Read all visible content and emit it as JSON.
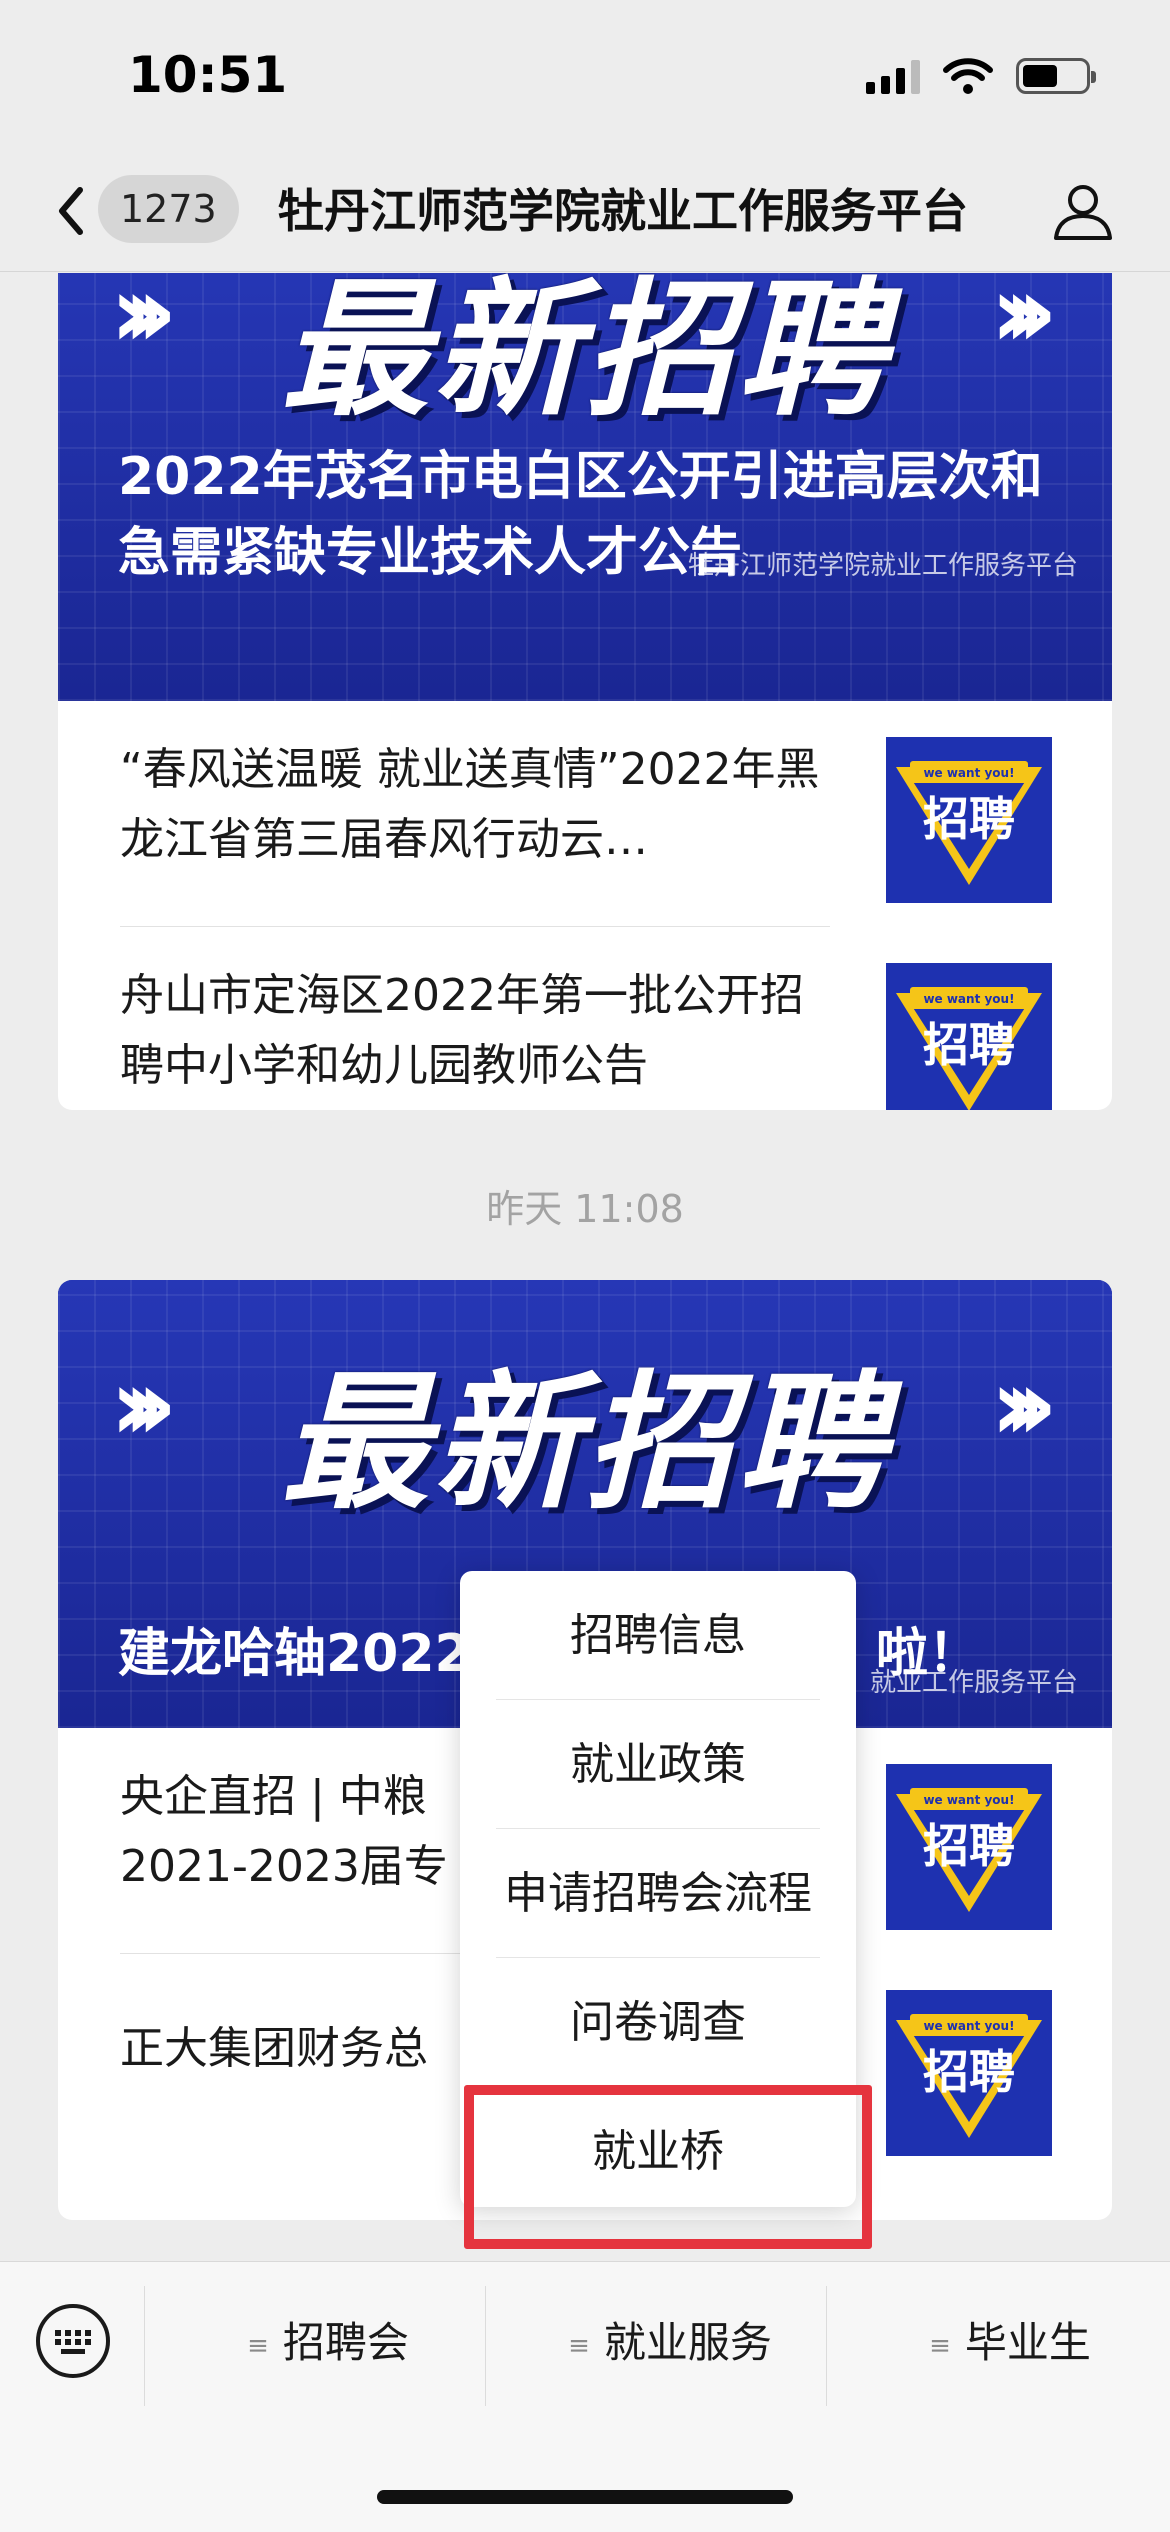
{
  "status_bar": {
    "time": "10:51"
  },
  "nav": {
    "unread_count": "1273",
    "title": "牡丹江师范学院就业工作服务平台"
  },
  "card1": {
    "banner": {
      "headline": "最新招聘",
      "caption": "2022年茂名市电白区公开引进高层次和急需紧缺专业技术人才公告",
      "watermark": "牡丹江师范学院就业工作服务平台"
    },
    "articles": [
      {
        "title": "“春风送温暖 就业送真情”2022年黑龙江省第三届春风行动云…"
      },
      {
        "title": "舟山市定海区2022年第一批公开招聘中小学和幼儿园教师公告"
      }
    ]
  },
  "timestamp": "昨天 11:08",
  "card2": {
    "banner": {
      "headline": "最新招聘",
      "caption": "建龙哈轴2022",
      "caption_tail": "啦！",
      "watermark": "就业工作服务平台"
    },
    "articles": [
      {
        "title": "央企直招 | 中粮"
      },
      {
        "title_line2": "2021-2023届专"
      },
      {
        "title": "正大集团财务总"
      }
    ]
  },
  "thumbnail": {
    "top_text": "we want you!",
    "main_text": "招聘"
  },
  "popup_menu": {
    "items": [
      "招聘信息",
      "就业政策",
      "申请招聘会流程",
      "问卷调查",
      "就业桥"
    ]
  },
  "bottom_menu": {
    "items": [
      "招聘会",
      "就业服务",
      "毕业生"
    ]
  },
  "colors": {
    "banner_blue": "#1e2a9c",
    "highlight_red": "#e5343e",
    "thumb_yellow": "#f5c518"
  },
  "icons": [
    "back-arrow-icon",
    "profile-icon",
    "keyboard-icon",
    "signal-icon",
    "wifi-icon",
    "battery-icon",
    "menu-list-icon"
  ]
}
